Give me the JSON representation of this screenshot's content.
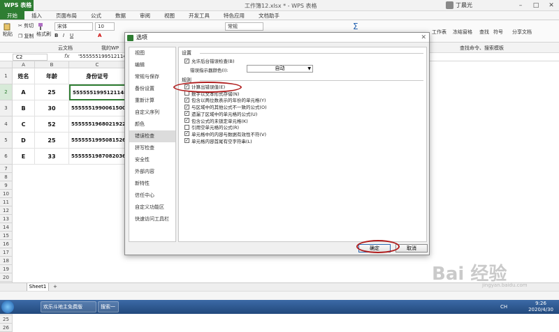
{
  "titlebar": {
    "app": "WPS 表格",
    "doc_title": "工作簿12.xlsx * - WPS 表格",
    "user": "丁晨光"
  },
  "menu": {
    "tabs": [
      "开始",
      "插入",
      "页面布局",
      "公式",
      "数据",
      "审阅",
      "视图",
      "开发工具",
      "特色应用",
      "文档助手"
    ]
  },
  "ribbon": {
    "paste": "粘贴",
    "cut": "剪切",
    "copy": "复制",
    "format_painter": "格式刷",
    "font": "宋体",
    "font_size": "10",
    "number_format": "常规",
    "worksheet": "工作表",
    "freeze": "冻结窗格",
    "find": "查找",
    "symbol": "符号",
    "share": "分享文档"
  },
  "tabstrip": {
    "cloud": "云文档",
    "mywps": "我的WP",
    "search": "查找命令、搜索模板"
  },
  "formula": {
    "cell_ref": "C2",
    "fx": "fx",
    "content": "'555555199512114823"
  },
  "grid": {
    "columns": [
      "A",
      "B",
      "C"
    ],
    "rows": [
      "1",
      "2",
      "3",
      "4",
      "5",
      "6",
      "7",
      "8",
      "9",
      "10",
      "11",
      "12",
      "13",
      "14",
      "15",
      "16",
      "17",
      "18",
      "19",
      "20",
      "21",
      "22",
      "23",
      "24",
      "25",
      "26"
    ],
    "headers": [
      "姓名",
      "年龄",
      "身份证号"
    ],
    "data": [
      [
        "A",
        "25",
        "555555199512114823"
      ],
      [
        "B",
        "30",
        "555555199006150012"
      ],
      [
        "C",
        "52",
        "555555196802192236"
      ],
      [
        "D",
        "25",
        "555555199508152616"
      ],
      [
        "E",
        "33",
        "555555198708203612"
      ]
    ]
  },
  "sheet": {
    "tab": "Sheet1",
    "add": "+"
  },
  "dialog": {
    "title": "选项",
    "close": "✕",
    "nav": [
      "视图",
      "编辑",
      "常规与保存",
      "备份设置",
      "重新计算",
      "自定义序列",
      "颜色",
      "错误检查",
      "拼写检查",
      "安全性",
      "外部内容",
      "新特性",
      "信任中心",
      "自定义功能区",
      "快速访问工具栏"
    ],
    "active_nav": "错误检查",
    "settings_label": "设置",
    "enable_bg_check": "允许后台错误检查(B)",
    "indicator_color_label": "错误指示器颜色(I):",
    "indicator_color_value": "自动",
    "rules_label": "规则",
    "rules": [
      {
        "label": "计算出错误值(E)",
        "checked": true
      },
      {
        "label": "数字以文本形式存储(N)",
        "checked": false
      },
      {
        "label": "包含以两位数表示的年份的单元格(Y)",
        "checked": true
      },
      {
        "label": "与区域中的其他公式不一致的公式(O)",
        "checked": true
      },
      {
        "label": "遗漏了区域中的单元格的公式(U)",
        "checked": true
      },
      {
        "label": "包含公式的未锁定单元格(K)",
        "checked": true
      },
      {
        "label": "引用空单元格的公式(R)",
        "checked": false
      },
      {
        "label": "单元格中的内容与数据有效性不符(V)",
        "checked": true
      },
      {
        "label": "单元格内容首尾有空字符串(L)",
        "checked": true
      }
    ],
    "ok": "确定",
    "cancel": "取消"
  },
  "taskbar": {
    "item1": "欢乐斗地主免费版",
    "search": "搜索一下",
    "time": "9:26",
    "date": "2020/4/30",
    "lang": "CH"
  },
  "watermark": {
    "text": "Bai 经验",
    "url": "jingyan.baidu.com"
  },
  "colors": {
    "accent": "#2e7d32",
    "annotation": "#b01c1c",
    "selection": "#2e7d32"
  }
}
